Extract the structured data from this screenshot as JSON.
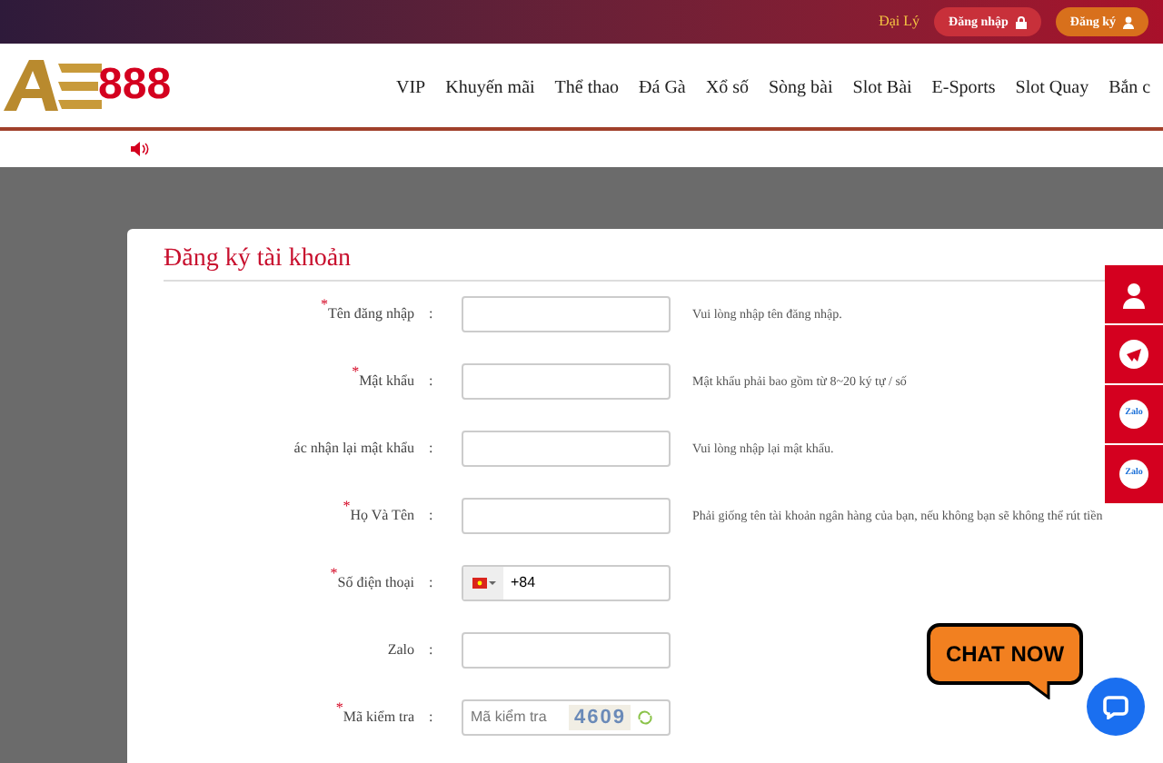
{
  "top_bar": {
    "agent_link": "Đại Lý",
    "login_button": "Đăng nhập",
    "register_button": "Đăng ký"
  },
  "header": {
    "logo_text": "888",
    "nav": [
      "VIP",
      "Khuyến mãi",
      "Thể thao",
      "Đá Gà",
      "Xổ số",
      "Sòng bài",
      "Slot Bài",
      "E-Sports",
      "Slot Quay",
      "Bắn c"
    ]
  },
  "form": {
    "title": "Đăng ký tài khoản",
    "required_mark": "*",
    "label_separator": ":",
    "fields": [
      {
        "kind": "text",
        "label": "Tên đăng nhập",
        "required": true,
        "hint": "Vui lòng nhập tên đăng nhập."
      },
      {
        "kind": "text",
        "label": "Mật khẩu",
        "required": true,
        "hint": "Mật khẩu phải bao gồm từ 8~20 ký tự / số"
      },
      {
        "kind": "text",
        "label": "ác nhận lại mật khẩu",
        "required": false,
        "hint": "Vui lòng nhập lại mật khẩu."
      },
      {
        "kind": "text",
        "label": "Họ Và Tên",
        "required": true,
        "hint": "Phải giống tên tài khoản ngân hàng của bạn, nếu không bạn sẽ không thể rút tiền"
      },
      {
        "kind": "phone",
        "label": "Số điện thoại",
        "required": true,
        "value": "+84"
      },
      {
        "kind": "text",
        "label": "Zalo",
        "required": false
      },
      {
        "kind": "captcha",
        "label": "Mã kiểm tra",
        "required": true,
        "placeholder": "Mã kiểm tra",
        "captcha": "4609"
      }
    ]
  },
  "side_buttons": [
    {
      "kind": "support"
    },
    {
      "kind": "telegram"
    },
    {
      "kind": "zalo",
      "label": "Zalo"
    },
    {
      "kind": "zalo",
      "label": "Zalo"
    }
  ],
  "chat": {
    "bubble": "CHAT NOW"
  }
}
